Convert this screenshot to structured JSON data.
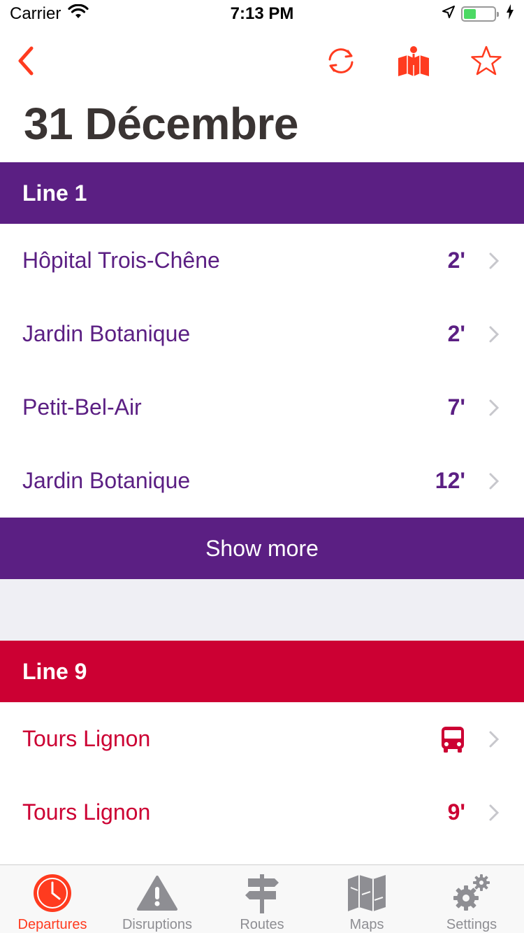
{
  "status_bar": {
    "carrier": "Carrier",
    "time": "7:13 PM"
  },
  "page": {
    "title": "31 Décembre"
  },
  "colors": {
    "accent": "#ff3b1f",
    "line1": "#5b1f83",
    "line9": "#cc0033",
    "text_dark": "#3a3433",
    "separator_bg": "#efeff4"
  },
  "toolbar": {
    "icons": [
      "back-icon",
      "refresh-icon",
      "map-pin-icon",
      "star-icon"
    ]
  },
  "line1": {
    "label": "Line 1",
    "departures": [
      {
        "destination": "Hôpital Trois-Chêne",
        "minutes": "2'"
      },
      {
        "destination": "Jardin Botanique",
        "minutes": "2'"
      },
      {
        "destination": "Petit-Bel-Air",
        "minutes": "7'"
      },
      {
        "destination": "Jardin Botanique",
        "minutes": "12'"
      }
    ],
    "show_more": "Show more"
  },
  "line9": {
    "label": "Line 9",
    "departures": [
      {
        "destination": "Tours Lignon",
        "minutes": "",
        "icon": "bus-icon"
      },
      {
        "destination": "Tours Lignon",
        "minutes": "9'"
      }
    ]
  },
  "tabs": [
    {
      "label": "Departures",
      "icon": "clock-icon",
      "active": true
    },
    {
      "label": "Disruptions",
      "icon": "warning-icon",
      "active": false
    },
    {
      "label": "Routes",
      "icon": "signpost-icon",
      "active": false
    },
    {
      "label": "Maps",
      "icon": "map-icon",
      "active": false
    },
    {
      "label": "Settings",
      "icon": "gear-icon",
      "active": false
    }
  ]
}
